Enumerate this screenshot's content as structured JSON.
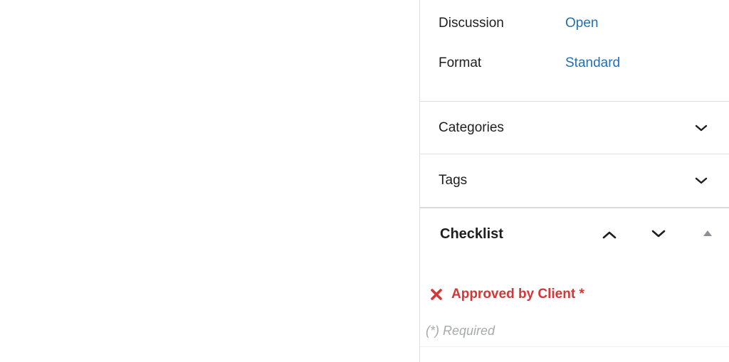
{
  "summary": {
    "discussion": {
      "label": "Discussion",
      "value": "Open"
    },
    "format": {
      "label": "Format",
      "value": "Standard"
    }
  },
  "panels": {
    "categories": {
      "title": "Categories"
    },
    "tags": {
      "title": "Tags"
    }
  },
  "checklist": {
    "title": "Checklist",
    "items": [
      {
        "label": "Approved by Client *",
        "status": "failed"
      }
    ],
    "required_note": "(*) Required"
  },
  "icons": {
    "panel_toggle": "chevron-down-icon",
    "move_up": "chevron-up-icon",
    "move_down": "chevron-down-icon",
    "collapse": "triangle-up-icon",
    "item_status": "x-icon"
  },
  "colors": {
    "link": "#2271b1",
    "error": "#d63638",
    "muted": "#a7aaad"
  }
}
